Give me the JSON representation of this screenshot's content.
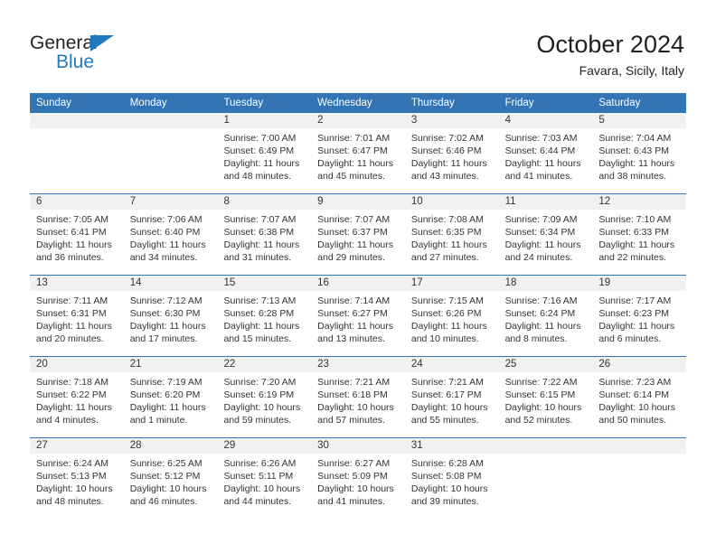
{
  "brand": {
    "name_top": "General",
    "name_bottom": "Blue",
    "color_dark": "#231f20",
    "color_blue": "#1f7ac0"
  },
  "header": {
    "title": "October 2024",
    "subtitle": "Favara, Sicily, Italy",
    "accent_color": "#3274b4",
    "band_color": "#f1f1f1"
  },
  "weekdays": [
    "Sunday",
    "Monday",
    "Tuesday",
    "Wednesday",
    "Thursday",
    "Friday",
    "Saturday"
  ],
  "weeks": [
    [
      {
        "day": "",
        "sunrise": "",
        "sunset": "",
        "daylight1": "",
        "daylight2": ""
      },
      {
        "day": "",
        "sunrise": "",
        "sunset": "",
        "daylight1": "",
        "daylight2": ""
      },
      {
        "day": "1",
        "sunrise": "Sunrise: 7:00 AM",
        "sunset": "Sunset: 6:49 PM",
        "daylight1": "Daylight: 11 hours",
        "daylight2": "and 48 minutes."
      },
      {
        "day": "2",
        "sunrise": "Sunrise: 7:01 AM",
        "sunset": "Sunset: 6:47 PM",
        "daylight1": "Daylight: 11 hours",
        "daylight2": "and 45 minutes."
      },
      {
        "day": "3",
        "sunrise": "Sunrise: 7:02 AM",
        "sunset": "Sunset: 6:46 PM",
        "daylight1": "Daylight: 11 hours",
        "daylight2": "and 43 minutes."
      },
      {
        "day": "4",
        "sunrise": "Sunrise: 7:03 AM",
        "sunset": "Sunset: 6:44 PM",
        "daylight1": "Daylight: 11 hours",
        "daylight2": "and 41 minutes."
      },
      {
        "day": "5",
        "sunrise": "Sunrise: 7:04 AM",
        "sunset": "Sunset: 6:43 PM",
        "daylight1": "Daylight: 11 hours",
        "daylight2": "and 38 minutes."
      }
    ],
    [
      {
        "day": "6",
        "sunrise": "Sunrise: 7:05 AM",
        "sunset": "Sunset: 6:41 PM",
        "daylight1": "Daylight: 11 hours",
        "daylight2": "and 36 minutes."
      },
      {
        "day": "7",
        "sunrise": "Sunrise: 7:06 AM",
        "sunset": "Sunset: 6:40 PM",
        "daylight1": "Daylight: 11 hours",
        "daylight2": "and 34 minutes."
      },
      {
        "day": "8",
        "sunrise": "Sunrise: 7:07 AM",
        "sunset": "Sunset: 6:38 PM",
        "daylight1": "Daylight: 11 hours",
        "daylight2": "and 31 minutes."
      },
      {
        "day": "9",
        "sunrise": "Sunrise: 7:07 AM",
        "sunset": "Sunset: 6:37 PM",
        "daylight1": "Daylight: 11 hours",
        "daylight2": "and 29 minutes."
      },
      {
        "day": "10",
        "sunrise": "Sunrise: 7:08 AM",
        "sunset": "Sunset: 6:35 PM",
        "daylight1": "Daylight: 11 hours",
        "daylight2": "and 27 minutes."
      },
      {
        "day": "11",
        "sunrise": "Sunrise: 7:09 AM",
        "sunset": "Sunset: 6:34 PM",
        "daylight1": "Daylight: 11 hours",
        "daylight2": "and 24 minutes."
      },
      {
        "day": "12",
        "sunrise": "Sunrise: 7:10 AM",
        "sunset": "Sunset: 6:33 PM",
        "daylight1": "Daylight: 11 hours",
        "daylight2": "and 22 minutes."
      }
    ],
    [
      {
        "day": "13",
        "sunrise": "Sunrise: 7:11 AM",
        "sunset": "Sunset: 6:31 PM",
        "daylight1": "Daylight: 11 hours",
        "daylight2": "and 20 minutes."
      },
      {
        "day": "14",
        "sunrise": "Sunrise: 7:12 AM",
        "sunset": "Sunset: 6:30 PM",
        "daylight1": "Daylight: 11 hours",
        "daylight2": "and 17 minutes."
      },
      {
        "day": "15",
        "sunrise": "Sunrise: 7:13 AM",
        "sunset": "Sunset: 6:28 PM",
        "daylight1": "Daylight: 11 hours",
        "daylight2": "and 15 minutes."
      },
      {
        "day": "16",
        "sunrise": "Sunrise: 7:14 AM",
        "sunset": "Sunset: 6:27 PM",
        "daylight1": "Daylight: 11 hours",
        "daylight2": "and 13 minutes."
      },
      {
        "day": "17",
        "sunrise": "Sunrise: 7:15 AM",
        "sunset": "Sunset: 6:26 PM",
        "daylight1": "Daylight: 11 hours",
        "daylight2": "and 10 minutes."
      },
      {
        "day": "18",
        "sunrise": "Sunrise: 7:16 AM",
        "sunset": "Sunset: 6:24 PM",
        "daylight1": "Daylight: 11 hours",
        "daylight2": "and 8 minutes."
      },
      {
        "day": "19",
        "sunrise": "Sunrise: 7:17 AM",
        "sunset": "Sunset: 6:23 PM",
        "daylight1": "Daylight: 11 hours",
        "daylight2": "and 6 minutes."
      }
    ],
    [
      {
        "day": "20",
        "sunrise": "Sunrise: 7:18 AM",
        "sunset": "Sunset: 6:22 PM",
        "daylight1": "Daylight: 11 hours",
        "daylight2": "and 4 minutes."
      },
      {
        "day": "21",
        "sunrise": "Sunrise: 7:19 AM",
        "sunset": "Sunset: 6:20 PM",
        "daylight1": "Daylight: 11 hours",
        "daylight2": "and 1 minute."
      },
      {
        "day": "22",
        "sunrise": "Sunrise: 7:20 AM",
        "sunset": "Sunset: 6:19 PM",
        "daylight1": "Daylight: 10 hours",
        "daylight2": "and 59 minutes."
      },
      {
        "day": "23",
        "sunrise": "Sunrise: 7:21 AM",
        "sunset": "Sunset: 6:18 PM",
        "daylight1": "Daylight: 10 hours",
        "daylight2": "and 57 minutes."
      },
      {
        "day": "24",
        "sunrise": "Sunrise: 7:21 AM",
        "sunset": "Sunset: 6:17 PM",
        "daylight1": "Daylight: 10 hours",
        "daylight2": "and 55 minutes."
      },
      {
        "day": "25",
        "sunrise": "Sunrise: 7:22 AM",
        "sunset": "Sunset: 6:15 PM",
        "daylight1": "Daylight: 10 hours",
        "daylight2": "and 52 minutes."
      },
      {
        "day": "26",
        "sunrise": "Sunrise: 7:23 AM",
        "sunset": "Sunset: 6:14 PM",
        "daylight1": "Daylight: 10 hours",
        "daylight2": "and 50 minutes."
      }
    ],
    [
      {
        "day": "27",
        "sunrise": "Sunrise: 6:24 AM",
        "sunset": "Sunset: 5:13 PM",
        "daylight1": "Daylight: 10 hours",
        "daylight2": "and 48 minutes."
      },
      {
        "day": "28",
        "sunrise": "Sunrise: 6:25 AM",
        "sunset": "Sunset: 5:12 PM",
        "daylight1": "Daylight: 10 hours",
        "daylight2": "and 46 minutes."
      },
      {
        "day": "29",
        "sunrise": "Sunrise: 6:26 AM",
        "sunset": "Sunset: 5:11 PM",
        "daylight1": "Daylight: 10 hours",
        "daylight2": "and 44 minutes."
      },
      {
        "day": "30",
        "sunrise": "Sunrise: 6:27 AM",
        "sunset": "Sunset: 5:09 PM",
        "daylight1": "Daylight: 10 hours",
        "daylight2": "and 41 minutes."
      },
      {
        "day": "31",
        "sunrise": "Sunrise: 6:28 AM",
        "sunset": "Sunset: 5:08 PM",
        "daylight1": "Daylight: 10 hours",
        "daylight2": "and 39 minutes."
      },
      {
        "day": "",
        "sunrise": "",
        "sunset": "",
        "daylight1": "",
        "daylight2": ""
      },
      {
        "day": "",
        "sunrise": "",
        "sunset": "",
        "daylight1": "",
        "daylight2": ""
      }
    ]
  ]
}
